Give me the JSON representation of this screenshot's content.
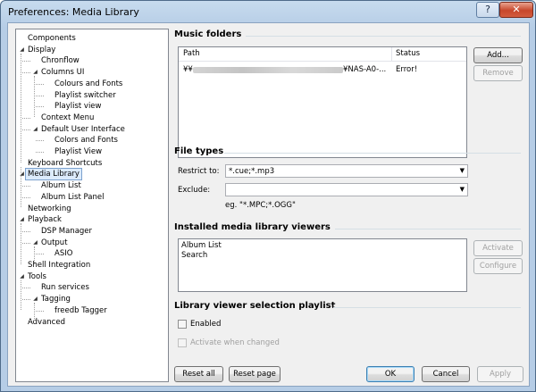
{
  "window": {
    "title": "Preferences: Media Library",
    "help_glyph": "?",
    "close_glyph": "✕"
  },
  "tree": {
    "items": [
      {
        "label": "Components",
        "level": 0,
        "expander": ""
      },
      {
        "label": "Display",
        "level": 0,
        "expander": "◢"
      },
      {
        "label": "Chronflow",
        "level": 1,
        "expander": ""
      },
      {
        "label": "Columns UI",
        "level": 1,
        "expander": "◢"
      },
      {
        "label": "Colours and Fonts",
        "level": 2,
        "expander": ""
      },
      {
        "label": "Playlist switcher",
        "level": 2,
        "expander": ""
      },
      {
        "label": "Playlist view",
        "level": 2,
        "expander": ""
      },
      {
        "label": "Context Menu",
        "level": 1,
        "expander": ""
      },
      {
        "label": "Default User Interface",
        "level": 1,
        "expander": "◢"
      },
      {
        "label": "Colors and Fonts",
        "level": 2,
        "expander": ""
      },
      {
        "label": "Playlist View",
        "level": 2,
        "expander": ""
      },
      {
        "label": "Keyboard Shortcuts",
        "level": 0,
        "expander": ""
      },
      {
        "label": "Media Library",
        "level": 0,
        "expander": "◢",
        "selected": true
      },
      {
        "label": "Album List",
        "level": 1,
        "expander": ""
      },
      {
        "label": "Album List Panel",
        "level": 1,
        "expander": ""
      },
      {
        "label": "Networking",
        "level": 0,
        "expander": ""
      },
      {
        "label": "Playback",
        "level": 0,
        "expander": "◢"
      },
      {
        "label": "DSP Manager",
        "level": 1,
        "expander": ""
      },
      {
        "label": "Output",
        "level": 1,
        "expander": "◢"
      },
      {
        "label": "ASIO",
        "level": 2,
        "expander": ""
      },
      {
        "label": "Shell Integration",
        "level": 0,
        "expander": ""
      },
      {
        "label": "Tools",
        "level": 0,
        "expander": "◢"
      },
      {
        "label": "Run services",
        "level": 1,
        "expander": ""
      },
      {
        "label": "Tagging",
        "level": 1,
        "expander": "◢"
      },
      {
        "label": "freedb Tagger",
        "level": 2,
        "expander": ""
      },
      {
        "label": "Advanced",
        "level": 0,
        "expander": ""
      }
    ]
  },
  "music_folders": {
    "title": "Music folders",
    "columns": {
      "path": "Path",
      "status": "Status"
    },
    "rows": [
      {
        "path_prefix": "¥¥",
        "path_suffix": "¥NAS-A0-...",
        "status": "Error!"
      }
    ],
    "add_label": "Add...",
    "remove_label": "Remove"
  },
  "file_types": {
    "title": "File types",
    "restrict_label": "Restrict to:",
    "restrict_value": "*.cue;*.mp3",
    "exclude_label": "Exclude:",
    "exclude_value": "",
    "example_hint": "eg. \"*.MPC;*.OGG\""
  },
  "viewers": {
    "title": "Installed media library viewers",
    "items": [
      "Album List",
      "Search"
    ],
    "activate_label": "Activate",
    "configure_label": "Configure"
  },
  "selection_playlist": {
    "title": "Library viewer selection playlist",
    "enabled_label": "Enabled",
    "activate_changed_label": "Activate when changed"
  },
  "footer": {
    "reset_all": "Reset all",
    "reset_page": "Reset page",
    "ok": "OK",
    "cancel": "Cancel",
    "apply": "Apply"
  }
}
